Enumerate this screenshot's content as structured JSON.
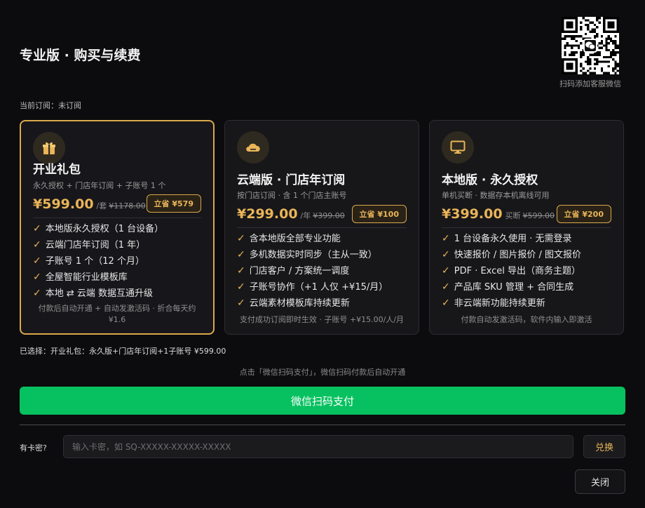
{
  "header": {
    "title": "专业版 · 购买与续费",
    "qr_caption": "扫码添加客服微信"
  },
  "subscription": {
    "current": "当前订阅：未订阅"
  },
  "plans": [
    {
      "name": "开业礼包",
      "icon": "gift-icon",
      "desc": "永久授权 + 门店年订阅 + 子账号 1 个",
      "price": "¥599.00",
      "unit": "/套",
      "original": "¥1178.00",
      "save": "立省 ¥579",
      "selected": true,
      "features": [
        "本地版永久授权（1 台设备）",
        "云端门店年订阅（1 年）",
        "子账号 1 个（12 个月）",
        "全屋智能行业模板库",
        "本地 ⇄ 云端 数据互通升级"
      ],
      "footnote": "付款后自动开通 + 自动发激活码 · 折合每天约 ¥1.6"
    },
    {
      "name": "云端版 · 门店年订阅",
      "icon": "cloud-icon",
      "desc": "按门店订阅 · 含 1 个门店主账号",
      "price": "¥299.00",
      "unit": "/年",
      "original": "¥399.00",
      "save": "立省 ¥100",
      "selected": false,
      "features": [
        "含本地版全部专业功能",
        "多机数据实时同步（主从一致）",
        "门店客户 / 方案统一调度",
        "子账号协作（+1 人仅 +¥15/月）",
        "云端素材模板库持续更新"
      ],
      "footnote": "支付成功订阅即时生效 · 子账号 +¥15.00/人/月"
    },
    {
      "name": "本地版 · 永久授权",
      "icon": "monitor-icon",
      "desc": "单机买断 · 数据存本机离线可用",
      "price": "¥399.00",
      "unit": "买断",
      "original": "¥599.00",
      "save": "立省 ¥200",
      "selected": false,
      "features": [
        "1 台设备永久使用 · 无需登录",
        "快速报价 / 图片报价 / 图文报价",
        "PDF · Excel 导出（商务主题）",
        "产品库 SKU 管理 + 合同生成",
        "非云端新功能持续更新"
      ],
      "footnote": "付款自动发激活码，软件内输入即激活"
    }
  ],
  "selection": {
    "text": "已选择：开业礼包：永久版+门店年订阅+1子账号 ¥599.00"
  },
  "payment": {
    "hint": "点击「微信扫码支付」，微信扫码付款后自动开通",
    "button": "微信扫码支付"
  },
  "redeem": {
    "label": "有卡密?",
    "placeholder": "输入卡密，如 SQ-XXXXX-XXXXX-XXXXX",
    "value": "",
    "button": "兑换"
  },
  "footer": {
    "close": "关闭"
  },
  "colors": {
    "accent_gold": "#e9b558",
    "wechat_green": "#07c160",
    "background": "#0c0c0e"
  }
}
